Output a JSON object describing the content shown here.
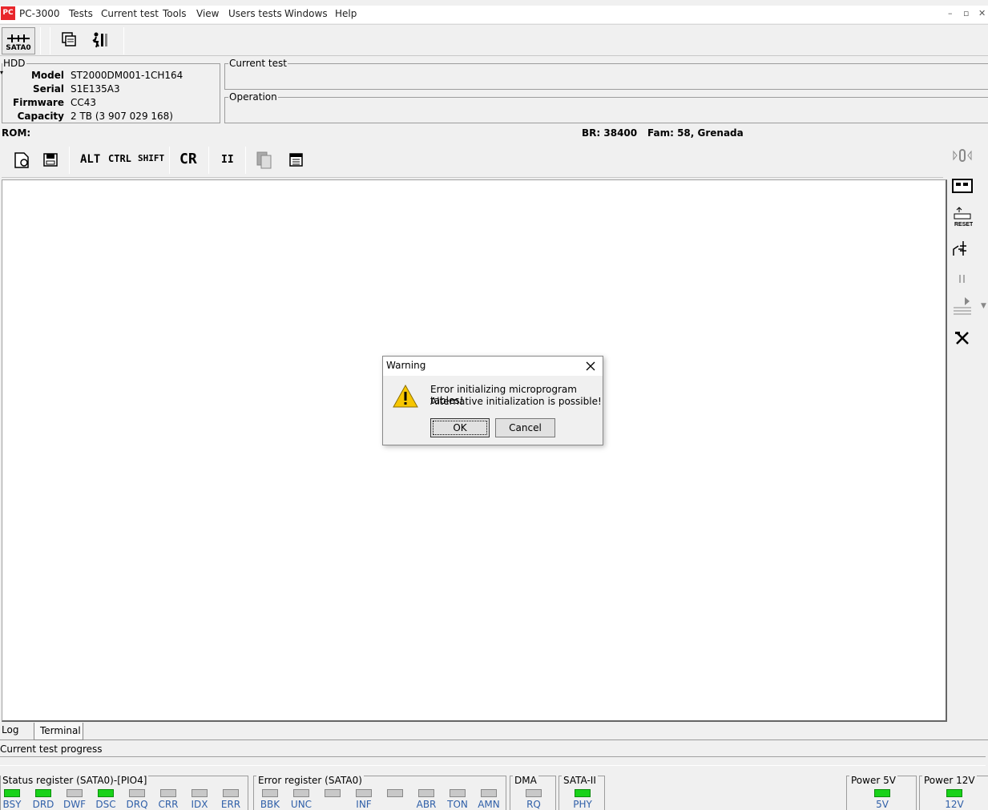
{
  "app": {
    "title": "PC-3000",
    "icon": "pc3000-logo-icon"
  },
  "menu": [
    "Tests",
    "Current test",
    "Tools",
    "View",
    "Users tests",
    "Windows",
    "Help"
  ],
  "window_controls": [
    "minimize-icon",
    "restore-icon",
    "close-icon"
  ],
  "toolbar": {
    "port_label": "SATA0"
  },
  "hdd": {
    "legend": "HDD",
    "model_label": "Model",
    "model": "ST2000DM001-1CH164",
    "serial_label": "Serial",
    "serial": "S1E135A3",
    "firmware_label": "Firmware",
    "firmware": "CC43",
    "capacity_label": "Capacity",
    "capacity": "2 TB (3 907 029 168)"
  },
  "panels": {
    "current_test": "Current test",
    "operation": "Operation"
  },
  "rom": {
    "label": "ROM:",
    "br": "BR: 38400",
    "fam": "Fam: 58, Grenada"
  },
  "terminal_toolbar": {
    "alt": "ALT",
    "ctrl": "CTRL",
    "shift": "SHIFT",
    "cr": "CR",
    "pause": "II"
  },
  "tabs": {
    "log": "Log",
    "terminal": "Terminal"
  },
  "progress": {
    "label": "Current test progress"
  },
  "dialog": {
    "title": "Warning",
    "line1": "Error initializing microprogram tables!",
    "line2": "Alternative initialization is possible!",
    "ok": "OK",
    "cancel": "Cancel",
    "icon": "warning-icon"
  },
  "status": {
    "status_register": {
      "title": "Status register (SATA0)-[PIO4]",
      "leds": [
        {
          "label": "BSY",
          "on": true
        },
        {
          "label": "DRD",
          "on": true
        },
        {
          "label": "DWF",
          "on": false
        },
        {
          "label": "DSC",
          "on": true
        },
        {
          "label": "DRQ",
          "on": false
        },
        {
          "label": "CRR",
          "on": false
        },
        {
          "label": "IDX",
          "on": false
        },
        {
          "label": "ERR",
          "on": false
        }
      ]
    },
    "error_register": {
      "title": "Error register (SATA0)",
      "leds": [
        {
          "label": "BBK",
          "on": false
        },
        {
          "label": "UNC",
          "on": false
        },
        {
          "label": "",
          "on": false
        },
        {
          "label": "INF",
          "on": false
        },
        {
          "label": "",
          "on": false
        },
        {
          "label": "ABR",
          "on": false
        },
        {
          "label": "TON",
          "on": false
        },
        {
          "label": "AMN",
          "on": false
        }
      ]
    },
    "dma": {
      "title": "DMA",
      "led": {
        "label": "RQ",
        "on": false
      }
    },
    "sata": {
      "title": "SATA-II",
      "led": {
        "label": "PHY",
        "on": true
      }
    },
    "power5": {
      "title": "Power 5V",
      "led": {
        "label": "5V",
        "on": true
      }
    },
    "power12": {
      "title": "Power 12V",
      "led": {
        "label": "12V",
        "on": true
      }
    }
  },
  "colors": {
    "led_on": "#19d219",
    "led_off": "#c8c8c8",
    "accent": "#e8262b",
    "led_label": "#2f5fa8"
  }
}
